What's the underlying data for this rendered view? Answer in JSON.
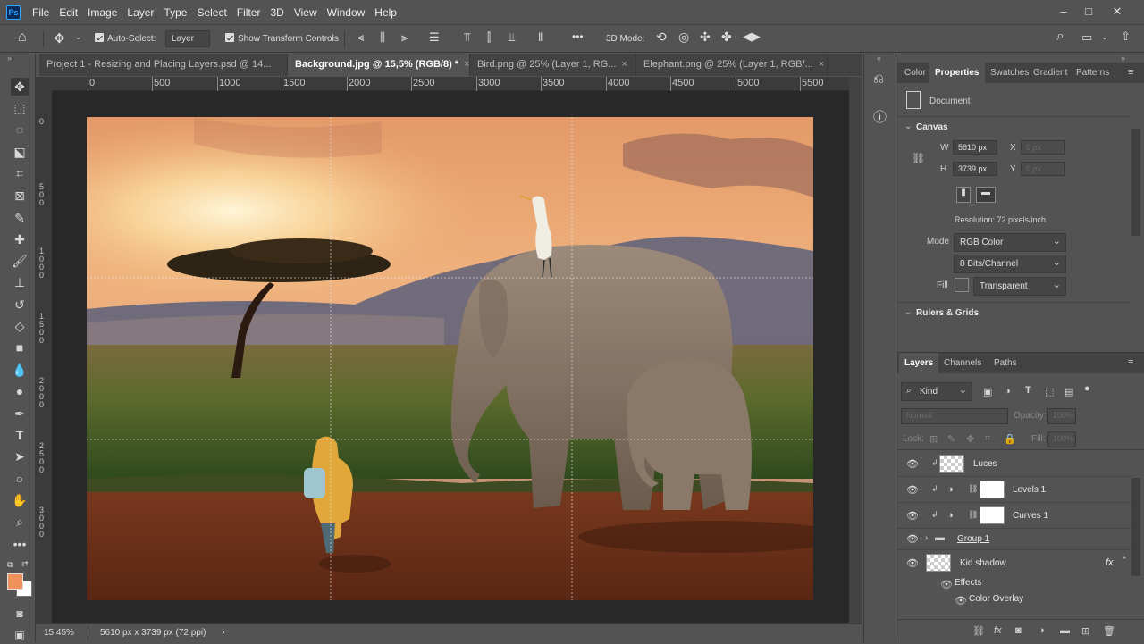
{
  "app": {
    "logo": "Ps"
  },
  "menu": [
    "File",
    "Edit",
    "Image",
    "Layer",
    "Type",
    "Select",
    "Filter",
    "3D",
    "View",
    "Window",
    "Help"
  ],
  "options": {
    "auto_select_label": "Auto-Select:",
    "auto_select_value": "Layer",
    "show_transform_label": "Show Transform Controls",
    "mode3d_label": "3D Mode:",
    "more": "•••"
  },
  "tabs": [
    {
      "label": "Project 1 - Resizing and Placing Layers.psd @ 14...",
      "active": false
    },
    {
      "label": "Background.jpg @ 15,5% (RGB/8) *",
      "active": true
    },
    {
      "label": "Bird.png @ 25% (Layer 1, RG...",
      "active": false
    },
    {
      "label": "Elephant.png @ 25% (Layer 1, RGB/...",
      "active": false
    }
  ],
  "ruler": {
    "top": [
      "0",
      "500",
      "1000",
      "1500",
      "2000",
      "2500",
      "3000",
      "3500",
      "4000",
      "4500",
      "5000",
      "5500"
    ],
    "left": [
      "0",
      "5\n0\n0",
      "1\n0\n0\n0",
      "1\n5\n0\n0",
      "2\n0\n0\n0",
      "2\n5\n0\n0",
      "3\n0\n0\n0"
    ]
  },
  "status": {
    "zoom": "15,45%",
    "info": "5610 px x 3739 px (72 ppi)"
  },
  "properties": {
    "tabs": [
      "Color",
      "Properties",
      "Swatches",
      "Gradient",
      "Patterns"
    ],
    "doc_label": "Document",
    "canvas_title": "Canvas",
    "w_label": "W",
    "w_value": "5610 px",
    "h_label": "H",
    "h_value": "3739 px",
    "x_label": "X",
    "x_placeholder": "0 px",
    "y_label": "Y",
    "y_placeholder": "0 px",
    "resolution": "Resolution: 72 pixels/inch",
    "mode_label": "Mode",
    "mode_value": "RGB Color",
    "bits_value": "8 Bits/Channel",
    "fill_label": "Fill",
    "fill_value": "Transparent",
    "rulers_title": "Rulers & Grids"
  },
  "layers_panel": {
    "tabs": [
      "Layers",
      "Channels",
      "Paths"
    ],
    "kind_label": "Kind",
    "blend_mode": "Normal",
    "opacity_label": "Opacity:",
    "opacity_value": "100%",
    "lock_label": "Lock:",
    "fill_label": "Fill:",
    "fill_value": "100%",
    "layers": [
      {
        "name": "Luces"
      },
      {
        "name": "Levels 1"
      },
      {
        "name": "Curves 1"
      },
      {
        "name": "Group 1"
      },
      {
        "name": "Kid shadow",
        "fx": "fx"
      }
    ],
    "effects_label": "Effects",
    "effect_item": "Color Overlay"
  },
  "colors": {
    "foreground": "#f0905a",
    "background": "#ffffff",
    "accent": "#31a8ff"
  }
}
